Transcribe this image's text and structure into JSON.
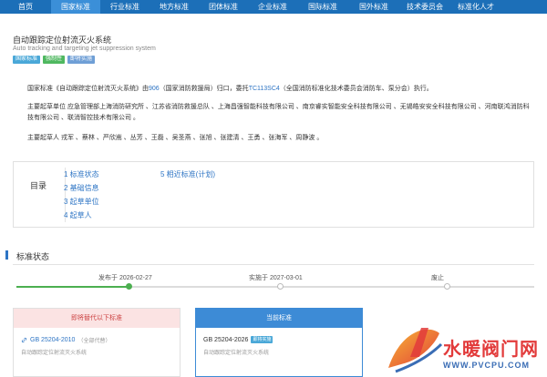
{
  "nav": {
    "items": [
      {
        "label": "首页",
        "active": false
      },
      {
        "label": "国家标准",
        "active": true
      },
      {
        "label": "行业标准",
        "active": false
      },
      {
        "label": "地方标准",
        "active": false
      },
      {
        "label": "团体标准",
        "active": false
      },
      {
        "label": "企业标准",
        "active": false
      },
      {
        "label": "国际标准",
        "active": false
      },
      {
        "label": "国外标准",
        "active": false
      },
      {
        "label": "技术委员会",
        "active": false
      },
      {
        "label": "标准化人才",
        "active": false
      }
    ]
  },
  "header": {
    "title_cn": "自动跟踪定位射流灭火系统",
    "title_en": "Auto tracking and targeting jet suppression system",
    "tags": [
      "国家标准",
      "强制性",
      "即将实施"
    ]
  },
  "description": {
    "p1_a": "国家标准《自动跟踪定位射流灭火系统》由",
    "p1_link1": "906",
    "p1_b": "（国家消防救援局）归口，委托",
    "p1_link2": "TC113SC4",
    "p1_c": "（全国消防标准化技术委员会消防车、泵分会）执行。",
    "p2": "主要起草单位 应急管理部上海消防研究所 、江苏省消防救援总队 、上海昌强智能科技有限公司 、南京睿实智能安全科技有限公司 、无锡皓安安全科技有限公司 、河南联鸿消防科技有限公司 、联消智控技术有限公司 。",
    "p3": "主要起草人 戎军 、蔡林 、严欣嵩 、丛芳 、王磊 、吴圣燕 、张旭 、张建清 、王勇 、张海军 、周静波 。"
  },
  "toc": {
    "label": "目录",
    "items": [
      "1 标准状态",
      "2 基础信息",
      "3 起草单位",
      "4 起草人",
      "5 相近标准(计划)"
    ]
  },
  "status": {
    "title": "标准状态",
    "published": "发布于 2026-02-27",
    "implemented": "实施于 2027-03-01",
    "abolished": "废止",
    "progress_fraction": 0.22
  },
  "replace_card": {
    "title": "即将替代以下标准",
    "code": "GB 25204-2010",
    "note": "（全部代替）",
    "name": "自动跟踪定位射流灭火系统"
  },
  "current_card": {
    "title": "当前标准",
    "code": "GB 25204-2026",
    "badge": "即将实施",
    "name": "自动跟踪定位射流灭火系统"
  },
  "watermark": {
    "text": "水暖阀门网",
    "url": "WWW.PVCPU.COM"
  },
  "colors": {
    "nav_bg": "#1c6fb8",
    "nav_active": "#3b8fd8",
    "link": "#2d74c4",
    "progress": "#4caf50",
    "replace_head": "#fbe3e3",
    "current_head": "#3d8bd6"
  }
}
